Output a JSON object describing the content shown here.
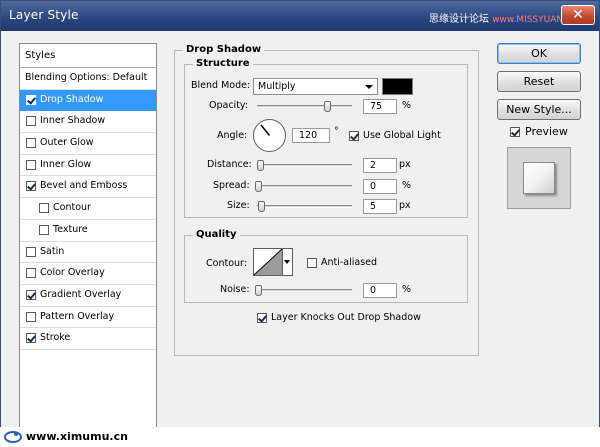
{
  "window": {
    "title": "Layer Style",
    "close_glyph": "✕"
  },
  "watermark": {
    "zh": "思缘设计论坛",
    "en": "www.MISSYUAN.COM",
    "footer": "www.ximumu.cn"
  },
  "styles": {
    "header": "Styles",
    "blending_options": "Blending Options: Default",
    "items": [
      {
        "label": "Drop Shadow",
        "checked": true
      },
      {
        "label": "Inner Shadow",
        "checked": false
      },
      {
        "label": "Outer Glow",
        "checked": false
      },
      {
        "label": "Inner Glow",
        "checked": false
      },
      {
        "label": "Bevel and Emboss",
        "checked": true
      },
      {
        "label": "Contour",
        "checked": false
      },
      {
        "label": "Texture",
        "checked": false
      },
      {
        "label": "Satin",
        "checked": false
      },
      {
        "label": "Color Overlay",
        "checked": false
      },
      {
        "label": "Gradient Overlay",
        "checked": true
      },
      {
        "label": "Pattern Overlay",
        "checked": false
      },
      {
        "label": "Stroke",
        "checked": true
      }
    ]
  },
  "drop_shadow": {
    "title": "Drop Shadow",
    "structure": {
      "title": "Structure",
      "blend_mode_label": "Blend Mode:",
      "blend_mode_value": "Multiply",
      "shadow_color": "#000000",
      "opacity_label": "Opacity:",
      "opacity_value": "75",
      "opacity_unit": "%",
      "opacity_fraction": 0.75,
      "angle_label": "Angle:",
      "angle_value": "120",
      "angle_unit": "°",
      "use_global_light_label": "Use Global Light",
      "use_global_light": true,
      "distance_label": "Distance:",
      "distance_value": "2",
      "distance_unit": "px",
      "spread_label": "Spread:",
      "spread_value": "0",
      "spread_unit": "%",
      "size_label": "Size:",
      "size_value": "5",
      "size_unit": "px"
    },
    "quality": {
      "title": "Quality",
      "contour_label": "Contour:",
      "anti_aliased_label": "Anti-aliased",
      "anti_aliased": false,
      "noise_label": "Noise:",
      "noise_value": "0",
      "noise_unit": "%"
    },
    "knockout_label": "Layer Knocks Out Drop Shadow",
    "knockout": true
  },
  "buttons": {
    "ok": "OK",
    "reset": "Reset",
    "new_style": "New Style...",
    "preview_label": "Preview",
    "preview_checked": true
  }
}
